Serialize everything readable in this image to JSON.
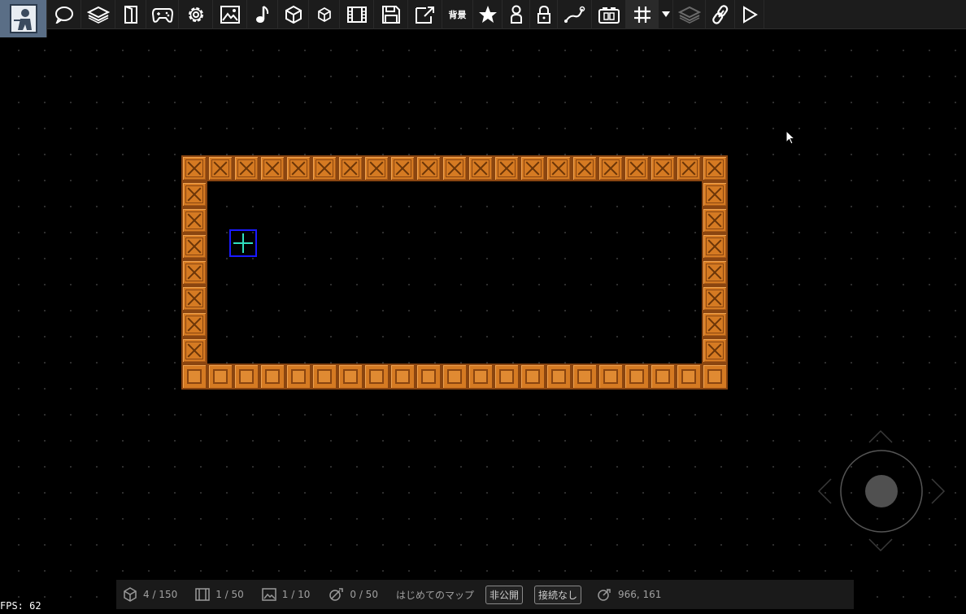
{
  "toolbar": {
    "background_label": "背景",
    "buttons": [
      "chat-icon",
      "layers-icon",
      "door-icon",
      "gamepad-icon",
      "gear-icon",
      "image-icon",
      "music-icon",
      "cube-icon",
      "small-cube-icon",
      "film-icon",
      "save-icon",
      "export-icon",
      "background-text",
      "star-icon",
      "person-icon",
      "lock-icon",
      "path-icon",
      "camera-icon",
      "grid-icon",
      "dropdown-icon",
      "layers-dim-icon",
      "link-icon",
      "play-icon"
    ]
  },
  "status": {
    "objects": "4 / 150",
    "scenes": "1 / 50",
    "images": "1 / 10",
    "effects": "0 / 50",
    "map_name": "はじめてのマップ",
    "visibility": "非公開",
    "connection": "接続なし",
    "coordinates": "966, 161"
  },
  "fps": "FPS: 62",
  "colors": {
    "block": "#d57a22",
    "block_edge": "#8a4510",
    "marker_border": "#1a1aff",
    "marker_cross": "#30e0c0"
  }
}
